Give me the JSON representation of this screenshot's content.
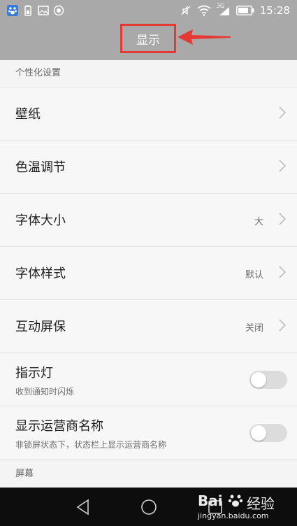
{
  "status_bar": {
    "time": "15:28",
    "network": "3G",
    "icons": [
      "baidu-paw-icon",
      "battery-saver-icon",
      "image-icon",
      "record-icon",
      "mute-icon",
      "wifi-icon",
      "signal-icon",
      "battery-icon"
    ]
  },
  "header": {
    "title": "显示"
  },
  "sections": [
    {
      "label": "个性化设置"
    },
    {
      "label": "屏幕"
    }
  ],
  "rows": [
    {
      "title": "壁纸",
      "value": ""
    },
    {
      "title": "色温调节",
      "value": ""
    },
    {
      "title": "字体大小",
      "value": "大"
    },
    {
      "title": "字体样式",
      "value": "默认"
    },
    {
      "title": "互动屏保",
      "value": "关闭"
    },
    {
      "title": "指示灯",
      "subtitle": "收到通知时闪烁",
      "toggle": false
    },
    {
      "title": "显示运营商名称",
      "subtitle": "非锁屏状态下，状态栏上显示运营商名称",
      "toggle": false
    }
  ],
  "watermark": {
    "brand": "Bai",
    "brand2": "经验",
    "url": "jingyan.baidu.com"
  },
  "colors": {
    "header_bg": "#a9a9a9",
    "highlight": "#e53935",
    "toggle_off": "#dcdcdc"
  }
}
